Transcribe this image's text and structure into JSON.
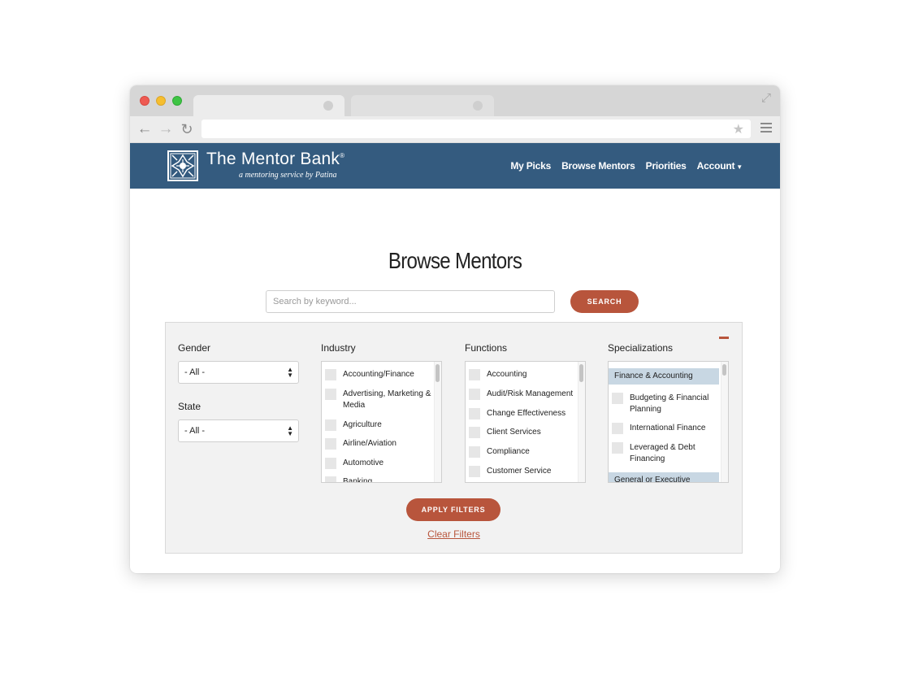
{
  "colors": {
    "header_bg": "#345b7f",
    "accent": "#b8553c",
    "panel_bg": "#f2f2f2",
    "group_highlight": "#c8d7e3"
  },
  "icons": {
    "back": "arrow-left",
    "forward": "arrow-right",
    "reload": "reload",
    "bookmark": "star",
    "menu": "hamburger",
    "fullscreen": "expand-arrows",
    "collapse": "minus"
  },
  "brand": {
    "title": "The Mentor Bank",
    "registered": "®",
    "subtitle": "a mentoring service by Patina"
  },
  "nav": {
    "my_picks": "My Picks",
    "browse_mentors": "Browse Mentors",
    "priorities": "Priorities",
    "account": "Account"
  },
  "page": {
    "title": "Browse Mentors"
  },
  "search": {
    "placeholder": "Search by keyword...",
    "button": "SEARCH"
  },
  "filters": {
    "gender": {
      "label": "Gender",
      "value": "- All -"
    },
    "state": {
      "label": "State",
      "value": "- All -"
    },
    "industry": {
      "label": "Industry",
      "items": [
        "Accounting/Finance",
        "Advertising, Marketing & Media",
        "Agriculture",
        "Airline/Aviation",
        "Automotive",
        "Banking"
      ]
    },
    "functions": {
      "label": "Functions",
      "items": [
        "Accounting",
        "Audit/Risk Management",
        "Change Effectiveness",
        "Client Services",
        "Compliance",
        "Customer Service"
      ]
    },
    "specializations": {
      "label": "Specializations",
      "group_1": "Finance & Accounting",
      "items": [
        "Budgeting & Financial Planning",
        "International Finance",
        "Leveraged & Debt Financing"
      ],
      "group_2": "General or Executive"
    },
    "apply_button": "APPLY FILTERS",
    "clear_link": "Clear Filters"
  }
}
